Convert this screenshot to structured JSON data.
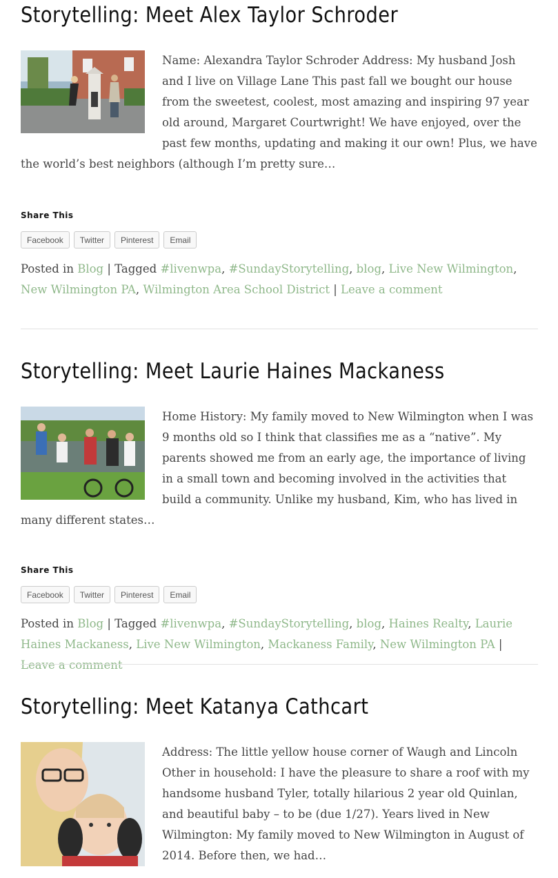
{
  "posts": [
    {
      "title": "Storytelling: Meet Alex Taylor Schroder",
      "excerpt": "Name: Alexandra Taylor Schroder Address: My husband Josh and I live on Village Lane This past fall we bought our house from the sweetest, coolest, most amazing and inspiring 97 year old around, Margaret Courtwright! We have enjoyed, over the past few months, updating and making it our own! Plus, we have the world’s best neighbors (although I’m pretty sure…",
      "share_title": "Share This",
      "share": [
        "Facebook",
        "Twitter",
        "Pinterest",
        "Email"
      ],
      "posted_in_label": "Posted in",
      "category": "Blog",
      "tagged_label": "Tagged",
      "tags": [
        "#livenwpa",
        "#SundayStorytelling",
        "blog",
        "Live New Wilmington",
        "New Wilmington PA",
        "Wilmington Area School District"
      ],
      "comment": "Leave a comment"
    },
    {
      "title": "Storytelling: Meet Laurie Haines Mackaness",
      "excerpt": "Home History: My family moved to New Wilmington when I was 9 months old so I think that classifies me as a “native”.  My parents showed me from an early age, the importance of living in a small town and becoming involved in the activities that build a community. Unlike my husband, Kim, who has lived in many different states…",
      "share_title": "Share This",
      "share": [
        "Facebook",
        "Twitter",
        "Pinterest",
        "Email"
      ],
      "posted_in_label": "Posted in",
      "category": "Blog",
      "tagged_label": "Tagged",
      "tags": [
        "#livenwpa",
        "#SundayStorytelling",
        "blog",
        "Haines Realty",
        "Laurie Haines Mackaness",
        "Live New Wilmington",
        "Mackaness Family",
        "New Wilmington PA"
      ],
      "comment": "Leave a comment"
    },
    {
      "title": "Storytelling: Meet Katanya Cathcart",
      "excerpt": "Address: The little yellow house corner of Waugh and Lincoln Other in household: I have the pleasure to share a roof with my handsome husband Tyler, totally hilarious 2 year old Quinlan, and beautiful baby – to be (due 1/27).   Years lived in New Wilmington: My family moved to New Wilmington in August of 2014. Before then, we had…"
    }
  ]
}
